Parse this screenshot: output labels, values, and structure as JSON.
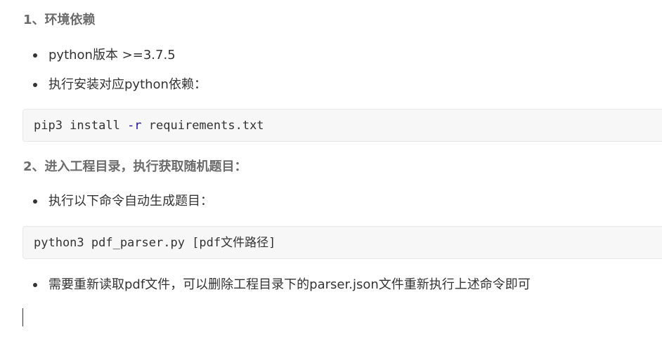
{
  "sections": [
    {
      "heading": "1、环境依赖",
      "bullets": [
        "python版本 >=3.7.5",
        "执行安装对应python依赖："
      ],
      "code": {
        "cmd": "pip3 install ",
        "flag": "-r",
        "arg": " requirements.txt"
      }
    },
    {
      "heading": "2、进入工程目录，执行获取随机题目：",
      "bullets": [
        "执行以下命令自动生成题目："
      ],
      "code": {
        "cmd": "python3 pdf_parser.py [pdf",
        "cjk": "文件路径",
        "close": "]"
      },
      "after_bullets": [
        "需要重新读取pdf文件，可以删除工程目录下的parser.json文件重新执行上述命令即可"
      ]
    }
  ]
}
